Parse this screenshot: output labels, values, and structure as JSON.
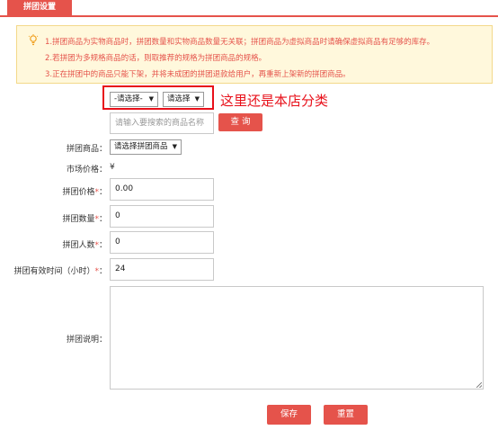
{
  "tab": {
    "label": "拼团设置"
  },
  "notice": {
    "lines": [
      "1.拼团商品为实物商品时，拼团数量和实物商品数量无关联；拼团商品为虚拟商品时请确保虚拟商品有足够的库存。",
      "2.若拼团为多规格商品的话，则取推荐的规格为拼团商品的规格。",
      "3.正在拼团中的商品只能下架，并将未成团的拼团退款给用户，再重新上架新的拼团商品。"
    ]
  },
  "category": {
    "select1": "-请选择-",
    "select2": "请选择",
    "annotation": "这里还是本店分类"
  },
  "search": {
    "placeholder": "请输入要搜索的商品名称",
    "button": "查 询"
  },
  "form": {
    "product_label": "拼团商品：",
    "product_select": "请选择拼团商品",
    "market_price_label": "市场价格：",
    "market_price_value": "¥",
    "group_price_label": "拼团价格",
    "group_price_value": "0.00",
    "group_qty_label": "拼团数量",
    "group_qty_value": "0",
    "group_people_label": "拼团人数",
    "group_people_value": "0",
    "valid_time_label": "拼团有效时间（小时）",
    "valid_time_value": "24",
    "desc_label": "拼团说明：",
    "required_mark": "*",
    "colon": "："
  },
  "actions": {
    "save": "保存",
    "reset": "重置"
  },
  "colors": {
    "accent": "#e5534b",
    "annotation": "#e8101a",
    "notice_bg": "#fff8dc"
  }
}
